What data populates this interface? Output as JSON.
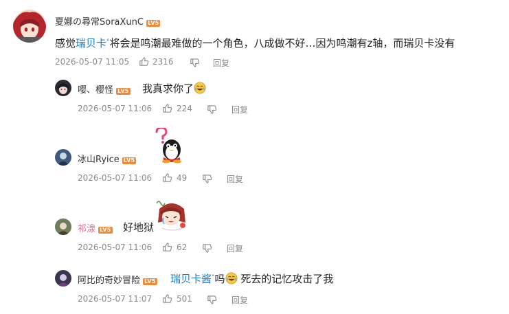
{
  "main_comment": {
    "username": "夏娜の尋常SoraXunC",
    "level": "LV5",
    "text_pre": "感觉",
    "mention": "瑞贝卡",
    "text_post": "将会是鸣潮最难做的一个角色，八成做不好…因为鸣潮有z轴，而瑞贝卡没有",
    "timestamp": "2026-05-07 11:05",
    "likes": "2316",
    "reply_label": "回复"
  },
  "replies": [
    {
      "username": "嘤、樱怪",
      "level": "LV5",
      "text": "我真求你了",
      "timestamp": "2026-05-07 11:06",
      "likes": "224",
      "reply_label": "回复"
    },
    {
      "username": "冰山Ryice",
      "level": "LV5",
      "timestamp": "2026-05-07 11:06",
      "likes": "49",
      "reply_label": "回复"
    },
    {
      "username": "祁湶",
      "level": "LV5",
      "text": "好地狱",
      "timestamp": "2026-05-07 11:06",
      "likes": "62",
      "reply_label": "回复"
    },
    {
      "username": "阿比的奇妙冒险",
      "level": "LV5",
      "mention": "瑞贝卡酱",
      "text_mid": "吗",
      "text_post": "死去的记忆攻击了我",
      "timestamp": "2026-05-07 11:07",
      "likes": "501",
      "reply_label": "回复"
    }
  ],
  "colors": {
    "link": "#1e7ac6",
    "level_badge": "#f08a3a",
    "meta": "#8a8a8a",
    "pink_name": "#e86c8f"
  }
}
